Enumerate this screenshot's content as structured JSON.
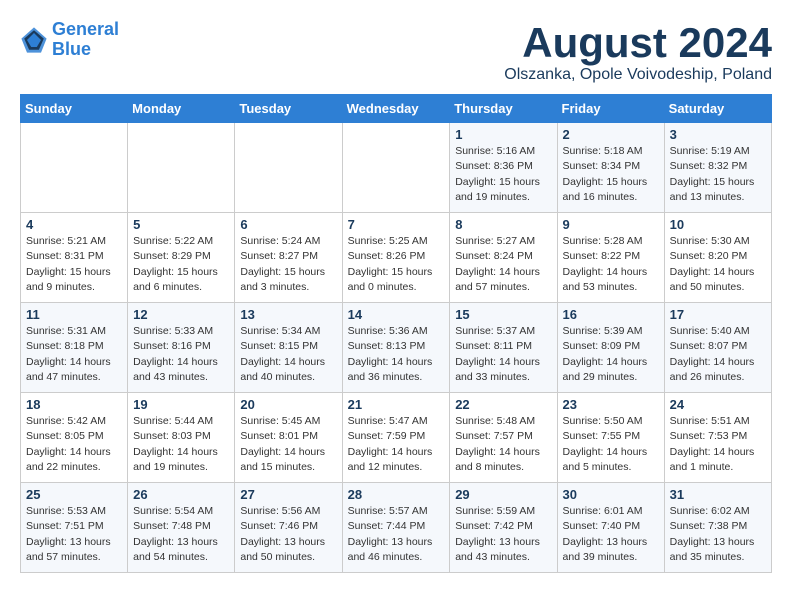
{
  "header": {
    "logo_line1": "General",
    "logo_line2": "Blue",
    "month_title": "August 2024",
    "subtitle": "Olszanka, Opole Voivodeship, Poland"
  },
  "weekdays": [
    "Sunday",
    "Monday",
    "Tuesday",
    "Wednesday",
    "Thursday",
    "Friday",
    "Saturday"
  ],
  "weeks": [
    [
      {
        "day": "",
        "info": ""
      },
      {
        "day": "",
        "info": ""
      },
      {
        "day": "",
        "info": ""
      },
      {
        "day": "",
        "info": ""
      },
      {
        "day": "1",
        "info": "Sunrise: 5:16 AM\nSunset: 8:36 PM\nDaylight: 15 hours\nand 19 minutes."
      },
      {
        "day": "2",
        "info": "Sunrise: 5:18 AM\nSunset: 8:34 PM\nDaylight: 15 hours\nand 16 minutes."
      },
      {
        "day": "3",
        "info": "Sunrise: 5:19 AM\nSunset: 8:32 PM\nDaylight: 15 hours\nand 13 minutes."
      }
    ],
    [
      {
        "day": "4",
        "info": "Sunrise: 5:21 AM\nSunset: 8:31 PM\nDaylight: 15 hours\nand 9 minutes."
      },
      {
        "day": "5",
        "info": "Sunrise: 5:22 AM\nSunset: 8:29 PM\nDaylight: 15 hours\nand 6 minutes."
      },
      {
        "day": "6",
        "info": "Sunrise: 5:24 AM\nSunset: 8:27 PM\nDaylight: 15 hours\nand 3 minutes."
      },
      {
        "day": "7",
        "info": "Sunrise: 5:25 AM\nSunset: 8:26 PM\nDaylight: 15 hours\nand 0 minutes."
      },
      {
        "day": "8",
        "info": "Sunrise: 5:27 AM\nSunset: 8:24 PM\nDaylight: 14 hours\nand 57 minutes."
      },
      {
        "day": "9",
        "info": "Sunrise: 5:28 AM\nSunset: 8:22 PM\nDaylight: 14 hours\nand 53 minutes."
      },
      {
        "day": "10",
        "info": "Sunrise: 5:30 AM\nSunset: 8:20 PM\nDaylight: 14 hours\nand 50 minutes."
      }
    ],
    [
      {
        "day": "11",
        "info": "Sunrise: 5:31 AM\nSunset: 8:18 PM\nDaylight: 14 hours\nand 47 minutes."
      },
      {
        "day": "12",
        "info": "Sunrise: 5:33 AM\nSunset: 8:16 PM\nDaylight: 14 hours\nand 43 minutes."
      },
      {
        "day": "13",
        "info": "Sunrise: 5:34 AM\nSunset: 8:15 PM\nDaylight: 14 hours\nand 40 minutes."
      },
      {
        "day": "14",
        "info": "Sunrise: 5:36 AM\nSunset: 8:13 PM\nDaylight: 14 hours\nand 36 minutes."
      },
      {
        "day": "15",
        "info": "Sunrise: 5:37 AM\nSunset: 8:11 PM\nDaylight: 14 hours\nand 33 minutes."
      },
      {
        "day": "16",
        "info": "Sunrise: 5:39 AM\nSunset: 8:09 PM\nDaylight: 14 hours\nand 29 minutes."
      },
      {
        "day": "17",
        "info": "Sunrise: 5:40 AM\nSunset: 8:07 PM\nDaylight: 14 hours\nand 26 minutes."
      }
    ],
    [
      {
        "day": "18",
        "info": "Sunrise: 5:42 AM\nSunset: 8:05 PM\nDaylight: 14 hours\nand 22 minutes."
      },
      {
        "day": "19",
        "info": "Sunrise: 5:44 AM\nSunset: 8:03 PM\nDaylight: 14 hours\nand 19 minutes."
      },
      {
        "day": "20",
        "info": "Sunrise: 5:45 AM\nSunset: 8:01 PM\nDaylight: 14 hours\nand 15 minutes."
      },
      {
        "day": "21",
        "info": "Sunrise: 5:47 AM\nSunset: 7:59 PM\nDaylight: 14 hours\nand 12 minutes."
      },
      {
        "day": "22",
        "info": "Sunrise: 5:48 AM\nSunset: 7:57 PM\nDaylight: 14 hours\nand 8 minutes."
      },
      {
        "day": "23",
        "info": "Sunrise: 5:50 AM\nSunset: 7:55 PM\nDaylight: 14 hours\nand 5 minutes."
      },
      {
        "day": "24",
        "info": "Sunrise: 5:51 AM\nSunset: 7:53 PM\nDaylight: 14 hours\nand 1 minute."
      }
    ],
    [
      {
        "day": "25",
        "info": "Sunrise: 5:53 AM\nSunset: 7:51 PM\nDaylight: 13 hours\nand 57 minutes."
      },
      {
        "day": "26",
        "info": "Sunrise: 5:54 AM\nSunset: 7:48 PM\nDaylight: 13 hours\nand 54 minutes."
      },
      {
        "day": "27",
        "info": "Sunrise: 5:56 AM\nSunset: 7:46 PM\nDaylight: 13 hours\nand 50 minutes."
      },
      {
        "day": "28",
        "info": "Sunrise: 5:57 AM\nSunset: 7:44 PM\nDaylight: 13 hours\nand 46 minutes."
      },
      {
        "day": "29",
        "info": "Sunrise: 5:59 AM\nSunset: 7:42 PM\nDaylight: 13 hours\nand 43 minutes."
      },
      {
        "day": "30",
        "info": "Sunrise: 6:01 AM\nSunset: 7:40 PM\nDaylight: 13 hours\nand 39 minutes."
      },
      {
        "day": "31",
        "info": "Sunrise: 6:02 AM\nSunset: 7:38 PM\nDaylight: 13 hours\nand 35 minutes."
      }
    ]
  ]
}
